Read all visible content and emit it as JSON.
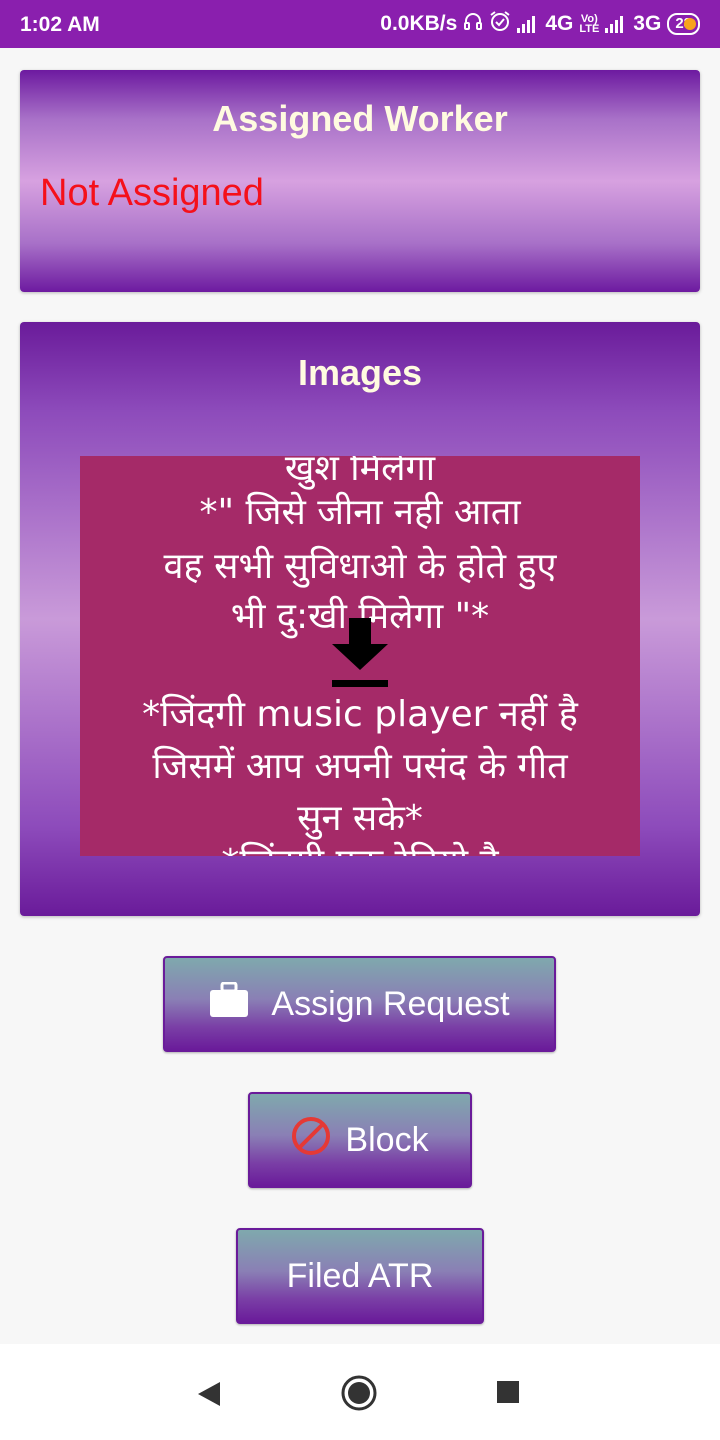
{
  "status_bar": {
    "time": "1:02 AM",
    "network_speed": "0.0KB/s",
    "network_4g": "4G",
    "volte_top": "Vo)",
    "volte_bottom": "LTE",
    "network_3g": "3G",
    "battery": "28"
  },
  "worker_card": {
    "title": "Assigned Worker",
    "status": "Not Assigned"
  },
  "images_card": {
    "title": "Images",
    "image_text_lines": [
      "खुश मिलेगा",
      "*\" जिसे जीना नही आता",
      "वह सभी सुविधाओ के होते हुए",
      "भी दु:खी मिलेगा \"*",
      "*जिंदगी music player नहीं है",
      "जिसमें आप अपनी पसंद के गीत",
      "सुन सके*",
      "*जिंदगी एक रेडियो है"
    ]
  },
  "buttons": {
    "assign_request": "Assign Request",
    "block": "Block",
    "filed_atr": "Filed ATR"
  },
  "colors": {
    "status_bar": "#8a1fae",
    "not_assigned": "#f5101a",
    "card_title": "#fffbe0",
    "image_background": "#a52a68",
    "button_border": "#6a1b9a",
    "block_icon": "#e53935"
  },
  "icons": {
    "headphones": "headphones-icon",
    "alarm": "alarm-icon",
    "download": "download-icon",
    "briefcase": "briefcase-icon",
    "block": "block-icon",
    "back": "back-icon",
    "home": "home-icon",
    "recents": "recents-icon"
  }
}
